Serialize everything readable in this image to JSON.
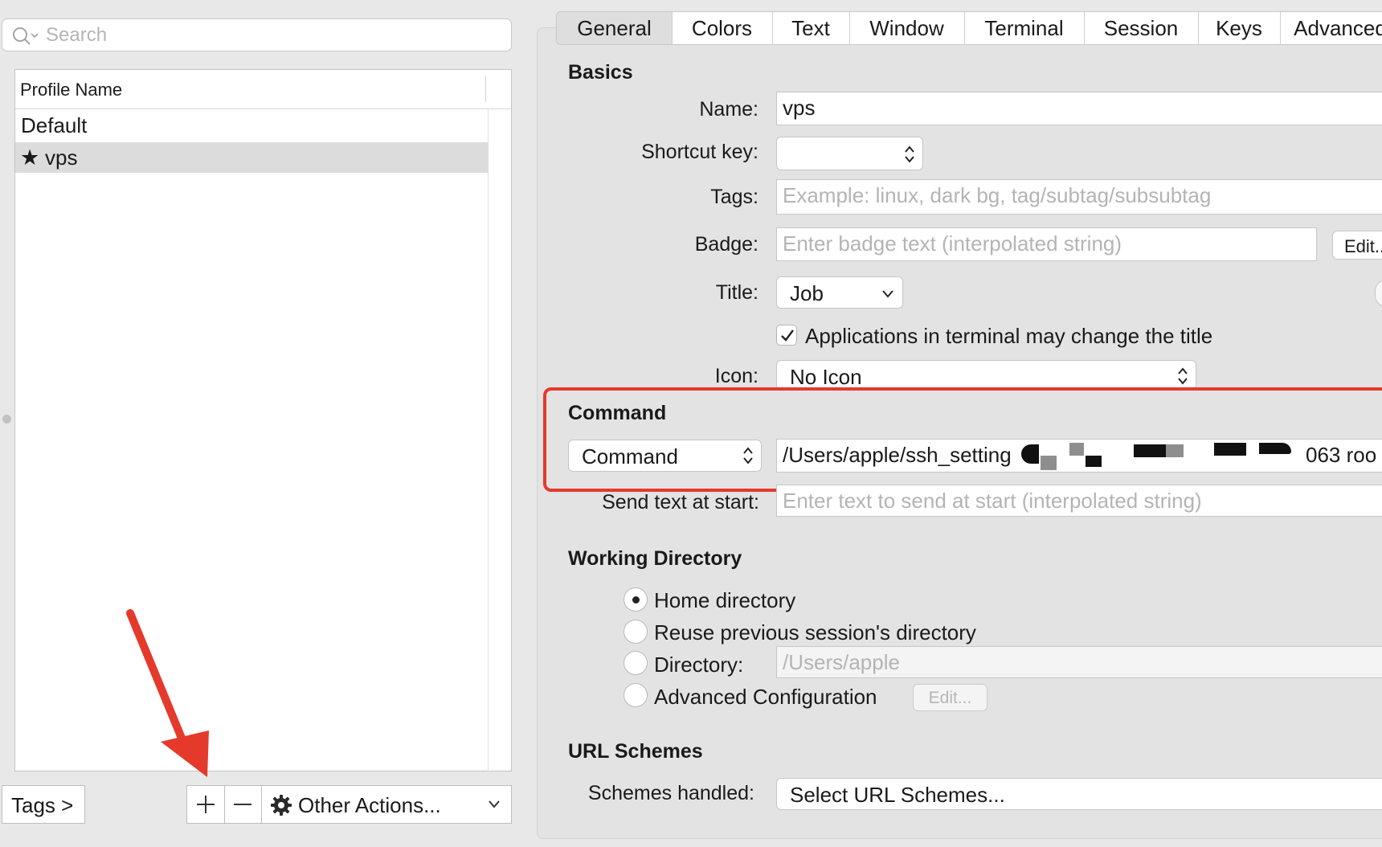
{
  "sidebar": {
    "search_placeholder": "Search",
    "column_header": "Profile Name",
    "profiles": [
      {
        "label": "Default",
        "starred": false
      },
      {
        "label": "vps",
        "starred": true
      }
    ],
    "tags_button": "Tags >",
    "other_actions": "Other Actions..."
  },
  "tabs": [
    "General",
    "Colors",
    "Text",
    "Window",
    "Terminal",
    "Session",
    "Keys",
    "Advanced"
  ],
  "basics": {
    "heading": "Basics",
    "name_label": "Name:",
    "name_value": "vps",
    "shortcut_label": "Shortcut key:",
    "tags_label": "Tags:",
    "tags_placeholder": "Example: linux, dark bg, tag/subtag/subsubtag",
    "badge_label": "Badge:",
    "badge_placeholder": "Enter badge text (interpolated string)",
    "badge_edit": "Edit...",
    "title_label": "Title:",
    "title_value": "Job",
    "title_checkbox": "Applications in terminal may change the title",
    "icon_label": "Icon:",
    "icon_value": "No Icon"
  },
  "command": {
    "heading": "Command",
    "mode": "Command",
    "value_start": "/Users/apple/ssh_setting",
    "value_end": "063 roo",
    "send_text_label": "Send text at start:",
    "send_text_placeholder": "Enter text to send at start (interpolated string)"
  },
  "working_directory": {
    "heading": "Working Directory",
    "options": [
      "Home directory",
      "Reuse previous session's directory",
      "Directory:",
      "Advanced Configuration"
    ],
    "directory_placeholder": "/Users/apple",
    "edit_button": "Edit..."
  },
  "url_schemes": {
    "heading": "URL Schemes",
    "schemes_label": "Schemes handled:",
    "schemes_value": "Select URL Schemes..."
  },
  "colors": {
    "highlight": "#e5392c",
    "selection": "#dcdcdc"
  }
}
